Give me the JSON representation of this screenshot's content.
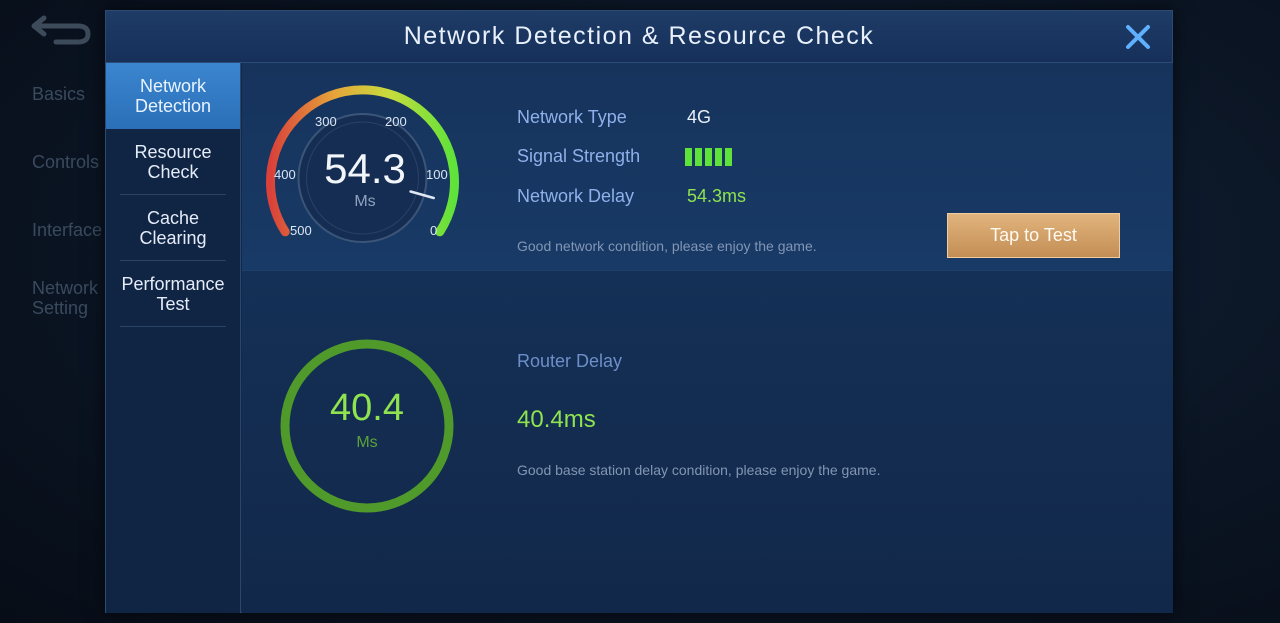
{
  "background": {
    "menu_items": [
      "Basics",
      "Controls",
      "Interface",
      "Network\nSetting"
    ]
  },
  "modal": {
    "title": "Network Detection & Resource Check"
  },
  "sidebar": {
    "tabs": [
      {
        "label": "Network\nDetection",
        "active": true
      },
      {
        "label": "Resource\nCheck",
        "active": false
      },
      {
        "label": "Cache\nClearing",
        "active": false
      },
      {
        "label": "Performance\nTest",
        "active": false
      }
    ]
  },
  "gauge": {
    "value": "54.3",
    "unit": "Ms",
    "ticks": [
      "500",
      "400",
      "300",
      "200",
      "100",
      "0"
    ],
    "max": 500,
    "reading": 54.3
  },
  "network": {
    "type_label": "Network Type",
    "type_value": "4G",
    "signal_label": "Signal Strength",
    "signal_bars": 5,
    "delay_label": "Network Delay",
    "delay_value": "54.3ms",
    "hint": "Good network condition, please enjoy the game.",
    "test_button": "Tap to Test"
  },
  "router": {
    "ring_value": "40.4",
    "ring_unit": "Ms",
    "label": "Router Delay",
    "value": "40.4ms",
    "hint": "Good base station delay condition, please enjoy the game."
  },
  "colors": {
    "good_green": "#8fe34f",
    "signal_green": "#5fe23a",
    "button_gold": "#d4a36b",
    "active_tab": "#3680cb"
  }
}
